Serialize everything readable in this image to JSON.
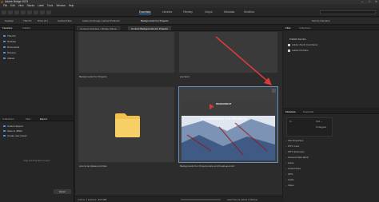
{
  "window": {
    "title": "Adobe Bridge 2023",
    "controls": [
      "—",
      "□",
      "✕"
    ]
  },
  "menu": [
    "File",
    "Edit",
    "View",
    "Stacks",
    "Label",
    "Tools",
    "Window",
    "Help"
  ],
  "workspaces": [
    {
      "label": "Essentials",
      "active": true
    },
    {
      "label": "Libraries",
      "active": false
    },
    {
      "label": "Filmstrip",
      "active": false
    },
    {
      "label": "Output",
      "active": false
    },
    {
      "label": "Metadata",
      "active": false
    },
    {
      "label": "Workflow",
      "active": false
    }
  ],
  "search": {
    "placeholder": "",
    "sort_label": "Sort by Filename"
  },
  "breadcrumbs": [
    "Desktop",
    "This PC",
    "Drive (C:)",
    "Cached Files",
    "Adobe Exchange Cached Products",
    "Backgrounds For Projects"
  ],
  "left_panel": {
    "tabs": [
      "Favorites",
      "Folders"
    ],
    "favorites": [
      "This PC",
      "Desktop",
      "Documents",
      "Pictures",
      "Videos"
    ]
  },
  "collections_panel": {
    "tabs": [
      "Collections",
      "Filter",
      "Export"
    ],
    "items": [
      "Custom Export",
      "Save to JPEG",
      "Create new preset"
    ],
    "hint": "Drag and drop files to export",
    "button": "Export"
  },
  "content": {
    "tabs": [
      "Content Unlimited + Bridge Videos",
      "Content Backgrounds For Projects"
    ],
    "top_labels": [
      "Backgrounds For Projects",
      "previews"
    ],
    "items": [
      {
        "caption": "premis templates psd files"
      },
      {
        "caption": "Backgrounds For Projects-Help and Freebees.indd"
      }
    ],
    "thumb_text": {
      "brand": "DESIGNDEAT",
      "headline": "BACKGROUNDS FOR PROJECTS"
    }
  },
  "statusbar": {
    "left": "4 items, 1 selected - 84.8 MB",
    "right": "Cast Files as Labels & Ratings"
  },
  "filter_panel": {
    "tabs": [
      "Filter",
      "Collections"
    ],
    "header": "Publish Service",
    "items": [
      "Adobe Stock Contributor",
      "Adobe Portfolio"
    ]
  },
  "metadata_panel": {
    "tabs": [
      "Metadata",
      "Keywords"
    ],
    "readouts": [
      {
        "label": "",
        "value": "f/--"
      },
      {
        "label": "",
        "value": "ISO --"
      },
      {
        "label": "",
        "value": "Untagged"
      }
    ],
    "sections": [
      "File Properties",
      "IPTC Core",
      "IPTC Extension",
      "Camera Data (Exif)",
      "Fonts",
      "Linked Files",
      "GPS",
      "Audio",
      "Video"
    ]
  },
  "colors": {
    "accent": "#2f8be6",
    "arrow": "#d93b3b",
    "folder": "#f2c14e"
  }
}
